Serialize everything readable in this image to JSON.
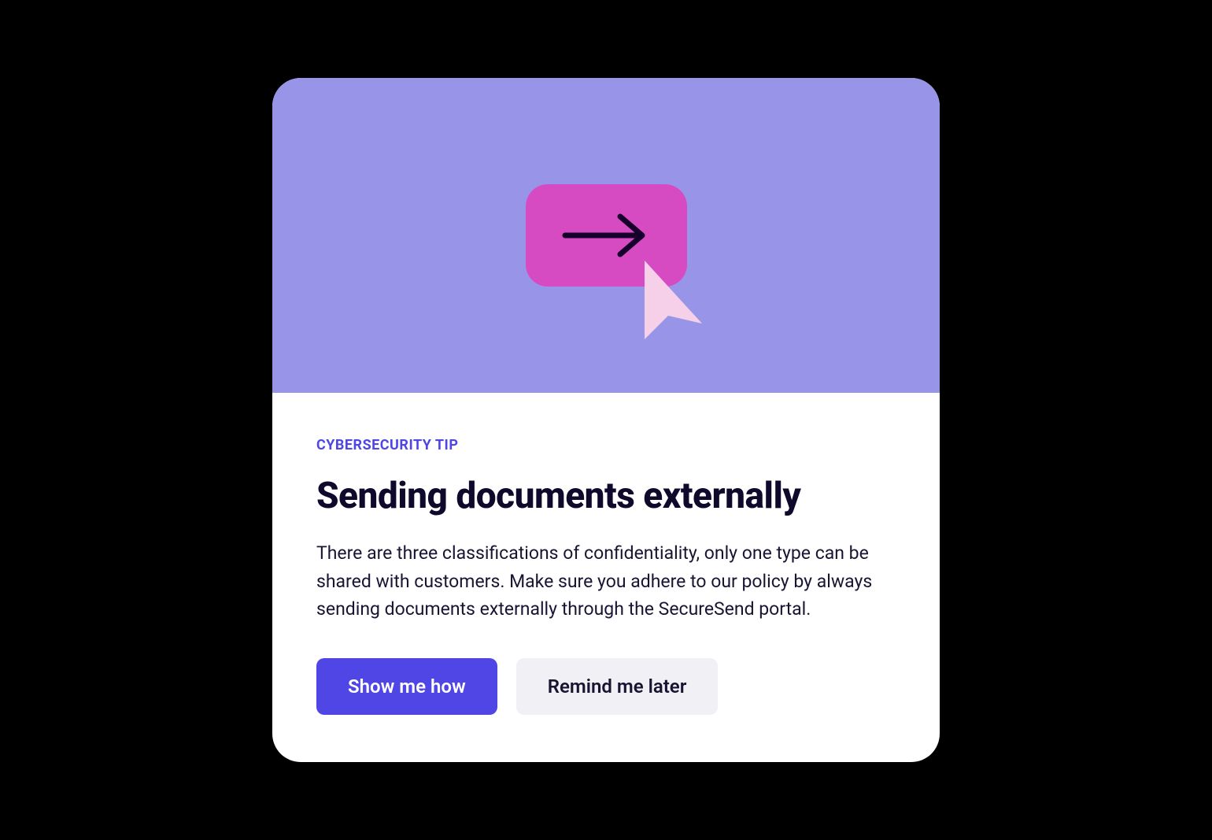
{
  "card": {
    "eyebrow": "CYBERSECURITY TIP",
    "title": "Sending documents externally",
    "body": "There are three classifications of confidentiality, only one type can be shared with customers. Make sure you adhere to our policy by always sending documents externally through the SecureSend portal.",
    "primary_button": "Show me how",
    "secondary_button": "Remind me later"
  },
  "colors": {
    "hero_bg": "#9895E8",
    "hero_button_bg": "#D64BC2",
    "cursor_fill": "#F6D0E8",
    "accent": "#4F46E5",
    "text_dark": "#0F0A2B",
    "secondary_bg": "#F1F0F5"
  }
}
